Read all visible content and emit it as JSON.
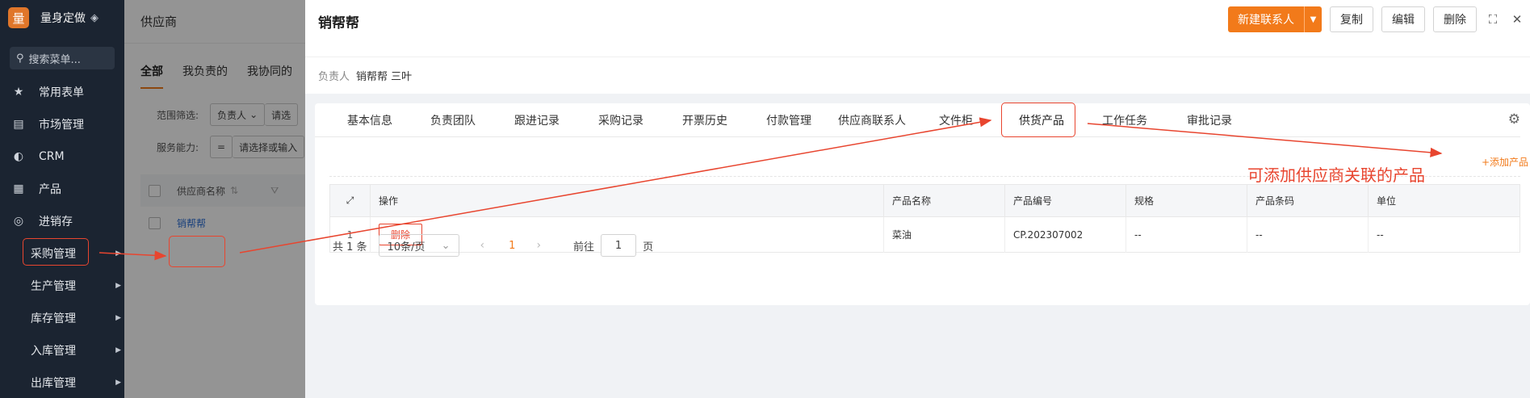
{
  "sidebar": {
    "brand_logo": "量",
    "brand_name": "量身定做",
    "search_placeholder": "搜索菜单...",
    "items": [
      {
        "label": "常用表单"
      },
      {
        "label": "市场管理"
      },
      {
        "label": "CRM"
      },
      {
        "label": "产品"
      },
      {
        "label": "进销存"
      }
    ],
    "subitems": [
      {
        "label": "采购管理"
      },
      {
        "label": "生产管理"
      },
      {
        "label": "库存管理"
      },
      {
        "label": "入库管理"
      },
      {
        "label": "出库管理"
      }
    ]
  },
  "background_page": {
    "title": "供应商",
    "tabs": [
      "全部",
      "我负责的",
      "我协同的"
    ],
    "filter1_label": "范围筛选:",
    "filter1_value": "负责人",
    "filter1_extra": "请选",
    "filter2_label": "服务能力:",
    "filter2_op": "=",
    "filter2_placeholder": "请选择或输入",
    "col_supplier": "供应商名称",
    "row_supplier": "销帮帮"
  },
  "drawer": {
    "title": "销帮帮",
    "actions": {
      "new_contact": "新建联系人",
      "copy": "复制",
      "edit": "编辑",
      "delete": "删除"
    },
    "owner_label": "负责人",
    "owner_value": "销帮帮 三叶",
    "tabs": [
      "基本信息",
      "负责团队",
      "跟进记录",
      "采购记录",
      "开票历史",
      "付款管理",
      "供应商联系人",
      "文件柜",
      "供货产品",
      "工作任务",
      "审批记录"
    ],
    "add_product": "+添加产品",
    "table": {
      "headers": [
        "操作",
        "产品名称",
        "产品编号",
        "规格",
        "产品条码",
        "单位"
      ],
      "rows": [
        {
          "index": "1",
          "action": "删除",
          "name": "菜油",
          "code": "CP.202307002",
          "spec": "--",
          "barcode": "--",
          "unit": "--"
        }
      ]
    },
    "pagination": {
      "total": "共 1 条",
      "page_size": "10条/页",
      "current": "1",
      "goto_label": "前往",
      "goto_value": "1",
      "page_suffix": "页"
    }
  },
  "annotation": "可添加供应商关联的产品",
  "colors": {
    "accent": "#f27a1a",
    "annotation": "#e8452f",
    "sidebar_bg": "#1b2431"
  }
}
